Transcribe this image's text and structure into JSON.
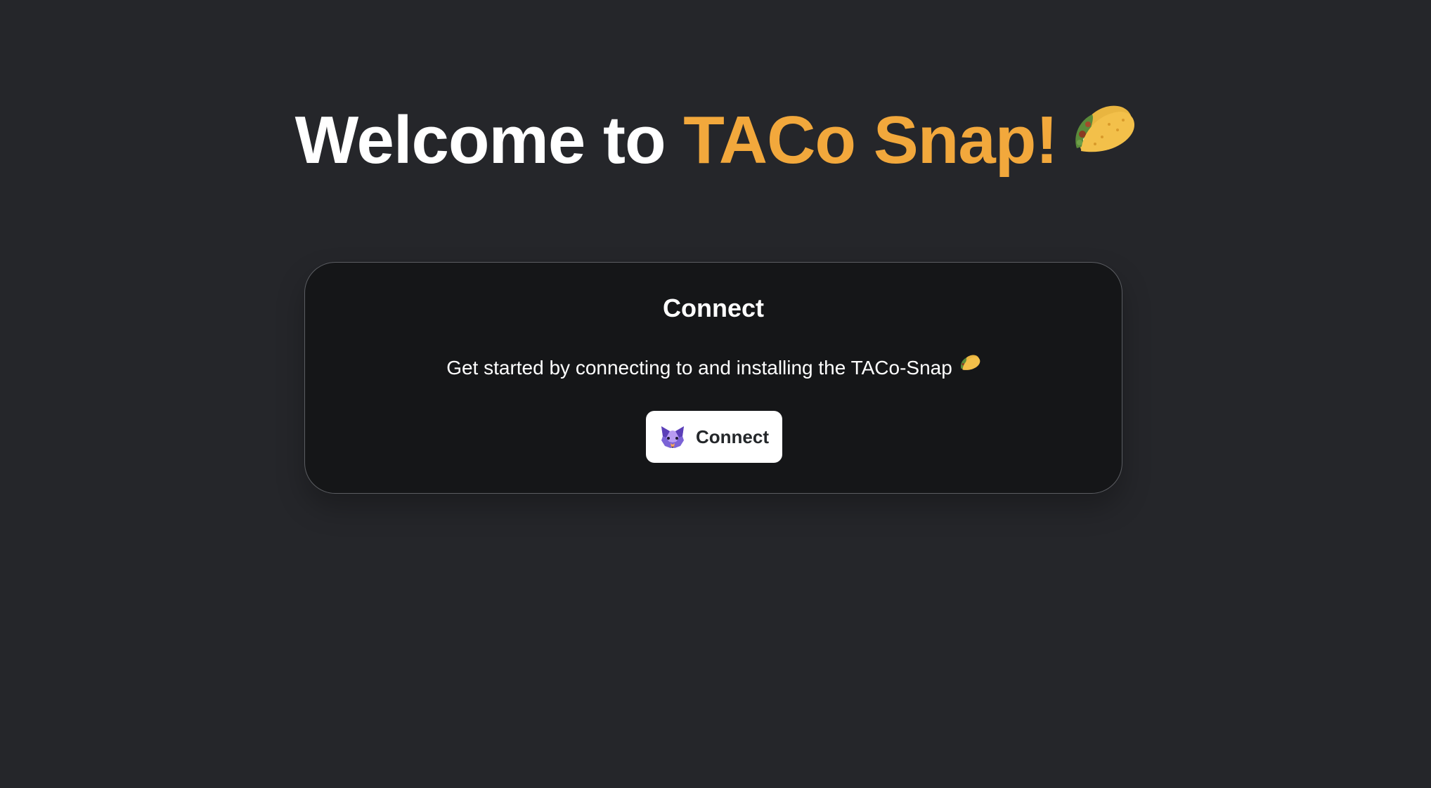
{
  "hero": {
    "title_prefix": "Welcome to ",
    "title_accent": "TACo Snap!",
    "title_emoji_icon": "taco-icon",
    "accent_color": "#f2a83c"
  },
  "connect_card": {
    "title": "Connect",
    "description": "Get started by connecting to and installing the TACo-Snap",
    "description_emoji_icon": "taco-icon",
    "button_label": "Connect",
    "button_icon": "metamask-fox-icon"
  }
}
